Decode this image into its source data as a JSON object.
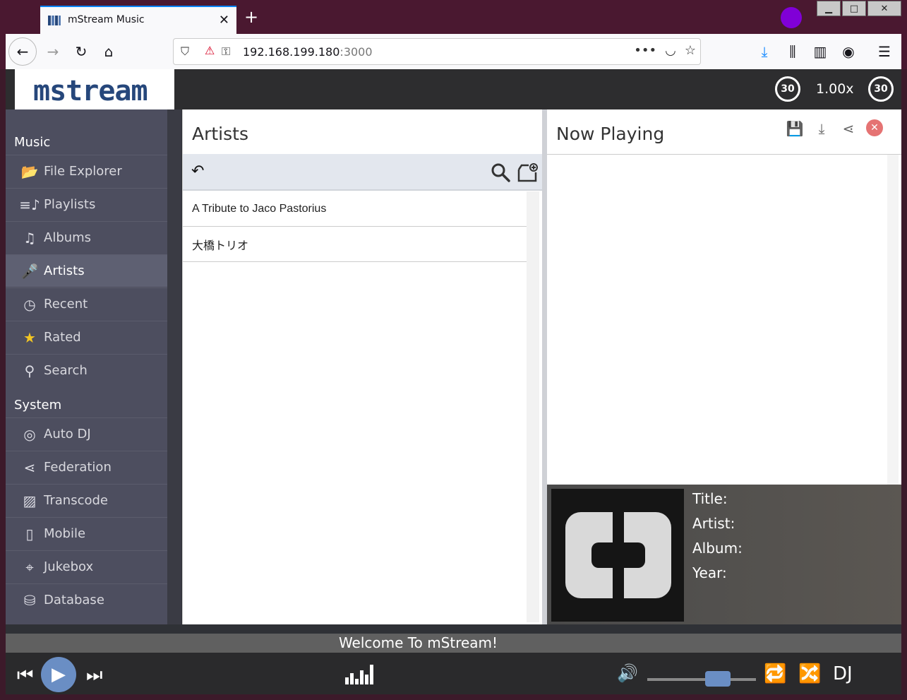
{
  "browser": {
    "tab_title": "mStream Music",
    "url_host": "192.168.199.180",
    "url_port": ":3000"
  },
  "header": {
    "logo": "mstream",
    "skip_back_label": "30",
    "speed": "1.00x",
    "skip_fwd_label": "30"
  },
  "sidebar": {
    "music_title": "Music",
    "music_items": [
      {
        "label": "File Explorer",
        "icon": "folder-icon"
      },
      {
        "label": "Playlists",
        "icon": "playlist-icon"
      },
      {
        "label": "Albums",
        "icon": "album-icon"
      },
      {
        "label": "Artists",
        "icon": "microphone-icon"
      },
      {
        "label": "Recent",
        "icon": "clock-icon"
      },
      {
        "label": "Rated",
        "icon": "star-icon"
      },
      {
        "label": "Search",
        "icon": "search-icon"
      }
    ],
    "system_title": "System",
    "system_items": [
      {
        "label": "Auto DJ",
        "icon": "disc-icon"
      },
      {
        "label": "Federation",
        "icon": "share-icon"
      },
      {
        "label": "Transcode",
        "icon": "transcode-icon"
      },
      {
        "label": "Mobile",
        "icon": "phone-icon"
      },
      {
        "label": "Jukebox",
        "icon": "remote-icon"
      },
      {
        "label": "Database",
        "icon": "database-icon"
      }
    ]
  },
  "artists": {
    "title": "Artists",
    "rows": [
      "A Tribute to Jaco Pastorius",
      "大橋トリオ"
    ]
  },
  "now_playing": {
    "title": "Now Playing",
    "meta_title": "Title:",
    "meta_artist": "Artist:",
    "meta_album": "Album:",
    "meta_year": "Year:"
  },
  "player": {
    "welcome": "Welcome To mStream!",
    "dj_label": "DJ",
    "volume": 0.58
  },
  "colors": {
    "accent": "#6a8ec4",
    "sidebar": "#4d4e5f",
    "logo": "#26477b"
  }
}
